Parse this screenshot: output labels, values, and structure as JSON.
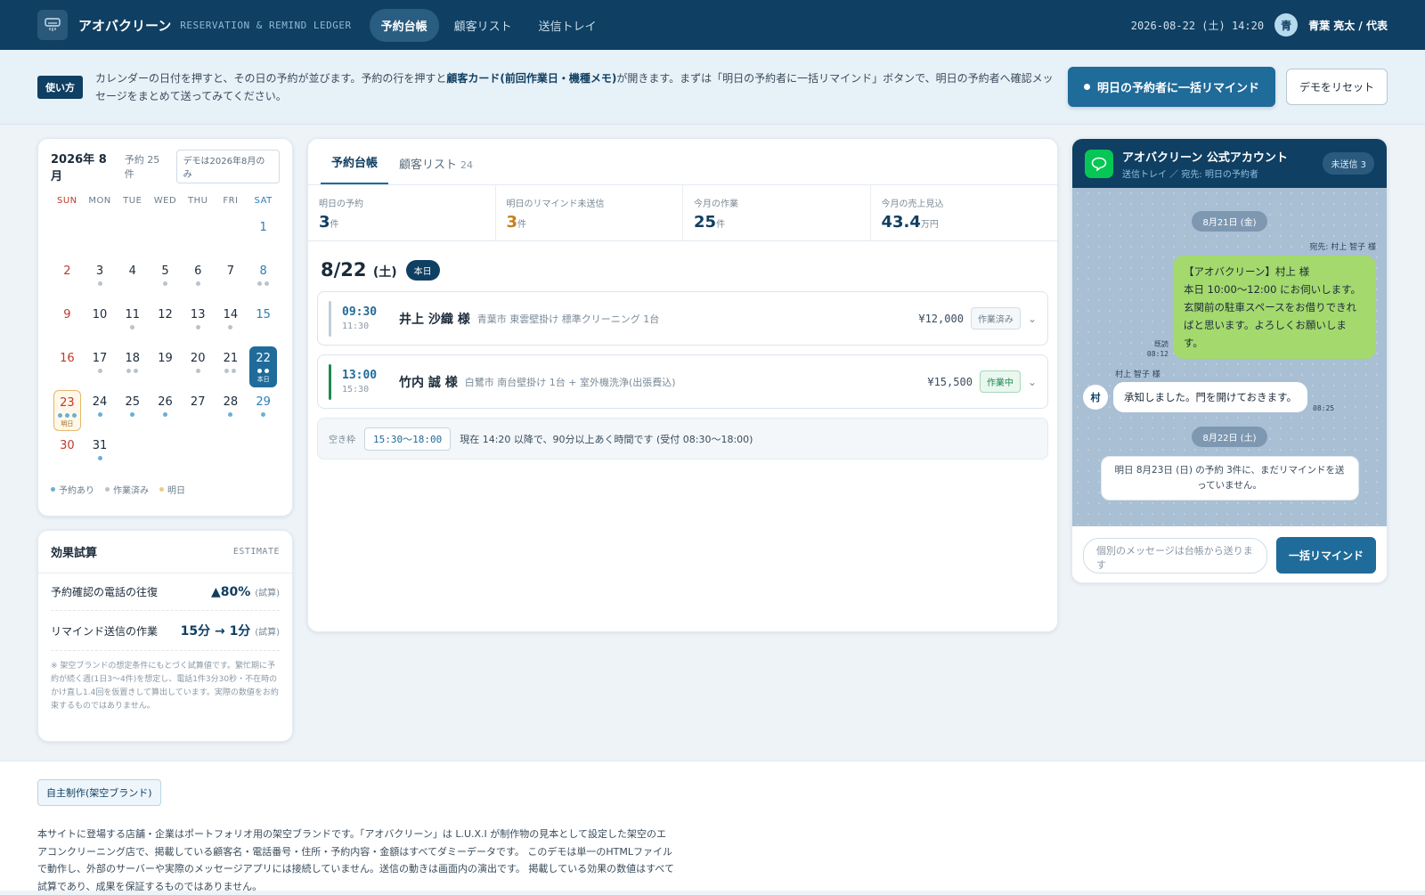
{
  "header": {
    "brand": "アオバクリーン",
    "brand_sub": "RESERVATION & REMIND LEDGER",
    "nav": [
      "予約台帳",
      "顧客リスト",
      "送信トレイ"
    ],
    "datetime": "2026-08-22 (土) 14:20",
    "avatar_initial": "青",
    "user": "青葉 亮太 / 代表"
  },
  "hint": {
    "badge": "使い方",
    "text_1": "カレンダーの日付を押すと、その日の予約が並びます。予約の行を押すと",
    "text_bold": "顧客カード(前回作業日・機種メモ)",
    "text_2": "が開きます。まずは「明日の予約者に一括リマインド」ボタンで、明日の予約者へ確認メッセージをまとめて送ってみてください。",
    "remind_button": "明日の予約者に一括リマインド",
    "reset_button": "デモをリセット"
  },
  "calendar": {
    "month": "2026年 8月",
    "count": "予約 25件",
    "note": "デモは2026年8月のみ",
    "dow": [
      "SUN",
      "MON",
      "TUE",
      "WED",
      "THU",
      "FRI",
      "SAT"
    ],
    "days": [
      {
        "n": "",
        "dots": ""
      },
      {
        "n": "",
        "dots": ""
      },
      {
        "n": "",
        "dots": ""
      },
      {
        "n": "",
        "dots": ""
      },
      {
        "n": "",
        "dots": ""
      },
      {
        "n": "",
        "dots": ""
      },
      {
        "n": "1",
        "dots": ""
      },
      {
        "n": "2",
        "dots": ""
      },
      {
        "n": "3",
        "dots": "g"
      },
      {
        "n": "4",
        "dots": ""
      },
      {
        "n": "5",
        "dots": "g"
      },
      {
        "n": "6",
        "dots": "g"
      },
      {
        "n": "7",
        "dots": ""
      },
      {
        "n": "8",
        "dots": "gg"
      },
      {
        "n": "9",
        "dots": ""
      },
      {
        "n": "10",
        "dots": ""
      },
      {
        "n": "11",
        "dots": "g"
      },
      {
        "n": "12",
        "dots": ""
      },
      {
        "n": "13",
        "dots": "g"
      },
      {
        "n": "14",
        "dots": "g"
      },
      {
        "n": "15",
        "dots": ""
      },
      {
        "n": "16",
        "dots": ""
      },
      {
        "n": "17",
        "dots": "g"
      },
      {
        "n": "18",
        "dots": "gg"
      },
      {
        "n": "19",
        "dots": ""
      },
      {
        "n": "20",
        "dots": "g"
      },
      {
        "n": "21",
        "dots": "gg"
      },
      {
        "n": "22",
        "dots": "ww",
        "state": "selected",
        "tag": "本日"
      },
      {
        "n": "23",
        "dots": "bbb",
        "state": "tomorrow",
        "tag": "明日"
      },
      {
        "n": "24",
        "dots": "b"
      },
      {
        "n": "25",
        "dots": "b"
      },
      {
        "n": "26",
        "dots": "b"
      },
      {
        "n": "27",
        "dots": ""
      },
      {
        "n": "28",
        "dots": "b"
      },
      {
        "n": "29",
        "dots": "b"
      },
      {
        "n": "30",
        "dots": ""
      },
      {
        "n": "31",
        "dots": "b"
      }
    ],
    "legend": [
      "予約あり",
      "作業済み",
      "明日"
    ]
  },
  "estimate": {
    "title": "効果試算",
    "tag": "ESTIMATE",
    "rows": [
      {
        "label": "予約確認の電話の往復",
        "value": "▲80%",
        "unit": "(試算)"
      },
      {
        "label": "リマインド送信の作業",
        "value": "15分 → 1分",
        "unit": "(試算)"
      }
    ],
    "note": "※ 架空ブランドの想定条件にもとづく試算値です。繁忙期に予約が続く週(1日3〜4件)を想定し、電話1件3分30秒・不在時のかけ直し1.4回を仮置きして算出しています。実際の数値をお約束するものではありません。"
  },
  "ledger": {
    "tabs": [
      {
        "label": "予約台帳",
        "count": ""
      },
      {
        "label": "顧客リスト",
        "count": "24"
      }
    ],
    "stats": [
      {
        "label": "明日の予約",
        "value": "3",
        "unit": "件"
      },
      {
        "label": "明日のリマインド未送信",
        "value": "3",
        "unit": "件"
      },
      {
        "label": "今月の作業",
        "value": "25",
        "unit": "件"
      },
      {
        "label": "今月の売上見込",
        "value": "43.4",
        "unit": "万円"
      }
    ],
    "date": "8/22",
    "weekday": "(土)",
    "today": "本日",
    "appointments": [
      {
        "start": "09:30",
        "end": "11:30",
        "name": "井上 沙織 様",
        "desc": "青葉市 東雲壁掛け 標準クリーニング 1台",
        "price": "¥12,000",
        "status": "作業済み"
      },
      {
        "start": "13:00",
        "end": "15:30",
        "name": "竹内 誠 様",
        "desc": "白鷺市 南台壁掛け 1台 + 室外機洗浄(出張費込)",
        "price": "¥15,500",
        "status": "作業中"
      }
    ],
    "free": {
      "label": "空き枠",
      "range": "15:30〜18:00",
      "text": "現在 14:20 以降で、90分以上あく時間です (受付 08:30〜18:00)"
    }
  },
  "chat": {
    "title": "アオバクリーン 公式アカウント",
    "subtitle": "送信トレイ ／ 宛先: 明日の予約者",
    "unsent": "未送信 3",
    "date1": "8月21日 (金)",
    "to": "宛先: 村上 智子 様",
    "out_msg_1": "【アオバクリーン】村上 様",
    "out_msg_2": "本日 10:00〜12:00 にお伺いします。玄関前の駐車スペースをお借りできればと思います。よろしくお願いします。",
    "read": "既読",
    "out_time": "08:12",
    "in_name": "村上 智子 様",
    "in_avatar": "村",
    "in_msg": "承知しました。門を開けておきます。",
    "in_time": "08:25",
    "date2": "8月22日 (土)",
    "sys_msg": "明日 8月23日 (日) の予約 3件に、まだリマインドを送っていません。",
    "input_placeholder": "個別のメッセージは台帳から送ります",
    "send_button": "一括リマインド"
  },
  "footer": {
    "badge": "自主制作(架空ブランド)",
    "text": "本サイトに登場する店舗・企業はポートフォリオ用の架空ブランドです。「アオバクリーン」は L.U.X.I が制作物の見本として設定した架空のエアコンクリーニング店で、掲載している顧客名・電話番号・住所・予約内容・金額はすべてダミーデータです。 このデモは単一のHTMLファイルで動作し、外部のサーバーや実際のメッセージアプリには接続していません。送信の動きは画面内の演出です。 掲載している効果の数値はすべて試算であり、成果を保証するものではありません。"
  },
  "colors": {
    "primary": "#0f3f62",
    "accent": "#1f6b9a",
    "line_green": "#06c755",
    "bubble_green": "#a4d96e"
  }
}
